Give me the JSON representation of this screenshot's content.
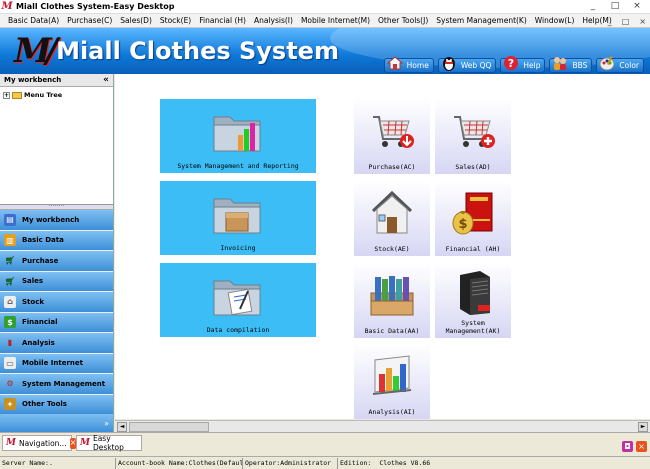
{
  "window": {
    "title": "Miall Clothes System-Easy Desktop",
    "controls": [
      "_",
      "□",
      "×"
    ]
  },
  "menu": {
    "items": [
      "Basic Data(A)",
      "Purchase(C)",
      "Sales(D)",
      "Stock(E)",
      "Financial (H)",
      "Analysis(I)",
      "Mobile Internet(M)",
      "Other Tools(J)",
      "System Management(K)",
      "Window(L)",
      "Help(M)"
    ],
    "controls": [
      "_",
      "□",
      "×"
    ]
  },
  "banner": {
    "logo": "M",
    "name": "Miall Clothes System",
    "buttons": [
      {
        "label": "Home",
        "icon": "home-icon"
      },
      {
        "label": "Web QQ",
        "icon": "penguin-icon"
      },
      {
        "label": "Help",
        "icon": "help-icon"
      },
      {
        "label": "BBS",
        "icon": "people-icon"
      },
      {
        "label": "Color",
        "icon": "palette-icon"
      }
    ]
  },
  "sidebar": {
    "header": "My workbench",
    "collapse": "«",
    "tree": {
      "expander": "+",
      "label": "Menu Tree"
    },
    "splitter": "········",
    "items": [
      {
        "label": "My workbench",
        "icon": "workbench-icon",
        "color": "#3a6fd0"
      },
      {
        "label": "Basic Data",
        "icon": "basic-data-icon",
        "color": "#e0a020"
      },
      {
        "label": "Purchase",
        "icon": "purchase-icon",
        "color": "#20a040"
      },
      {
        "label": "Sales",
        "icon": "sales-icon",
        "color": "#20a040"
      },
      {
        "label": "Stock",
        "icon": "stock-icon",
        "color": "#e8e8e8"
      },
      {
        "label": "Financial",
        "icon": "financial-icon",
        "color": "#30a030"
      },
      {
        "label": "Analysis",
        "icon": "analysis-icon",
        "color": "#d03030"
      },
      {
        "label": "Mobile Internet",
        "icon": "mobile-internet-icon",
        "color": "#e8e8e8"
      },
      {
        "label": "System Management",
        "icon": "system-management-icon",
        "color": "#d03030"
      },
      {
        "label": "Other Tools",
        "icon": "other-tools-icon",
        "color": "#c89020"
      }
    ],
    "more": "»"
  },
  "desktop": {
    "big_tiles": [
      {
        "label": "System Management and Reporting",
        "icon": "folder-chart-icon"
      },
      {
        "label": "Invoicing",
        "icon": "folder-box-icon"
      },
      {
        "label": "Data compilation",
        "icon": "folder-document-icon"
      }
    ],
    "tiles": [
      {
        "label": "Purchase(AC)",
        "icon": "cart-down-icon"
      },
      {
        "label": "Sales(AD)",
        "icon": "cart-plus-icon"
      },
      {
        "label": "Stock(AE)",
        "icon": "house-icon"
      },
      {
        "label": "Financial (AH)",
        "icon": "money-book-icon"
      },
      {
        "label": "Basic Data(AA)",
        "icon": "binders-icon"
      },
      {
        "label": "System Management(AK)",
        "icon": "server-icon"
      },
      {
        "label": "Analysis(AI)",
        "icon": "bar-chart-icon"
      }
    ]
  },
  "scrollbar": {
    "left": "◄",
    "right": "►"
  },
  "taskbar": {
    "tasks": [
      {
        "label": "Navigation...",
        "close": "×"
      },
      {
        "label": "Easy Desktop"
      }
    ],
    "right_buttons": [
      "◘",
      "×"
    ]
  },
  "status": {
    "server": "Server Name:.",
    "account": "Account-book Name:Clothes(Defaul",
    "operator": "Operator:Administrator",
    "edition_label": "Edition:",
    "edition": "Clothes V8.66"
  }
}
